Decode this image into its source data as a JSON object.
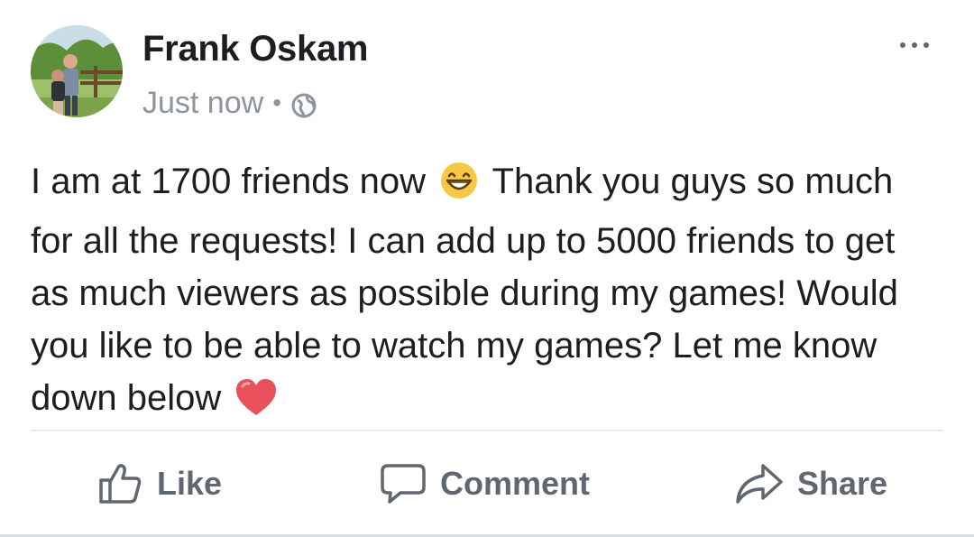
{
  "post": {
    "author": "Frank Oskam",
    "timestamp": "Just now",
    "separator": "•",
    "privacy_icon": "globe-icon",
    "more_icon": "more-options-icon",
    "text_line_1a": "I am at 1700 friends now",
    "text_line_1b": "Thank you guys so much for all the requests! I can add up to 5000 friends to get as much viewers as possible during my games! Would you like to be able to watch my games? Let me know down below",
    "emoji_1": "grinning-face-emoji",
    "emoji_2": "red-heart-emoji"
  },
  "actions": {
    "like_label": "Like",
    "comment_label": "Comment",
    "share_label": "Share"
  },
  "colors": {
    "text_primary": "#1c1e21",
    "text_secondary": "#8d949e",
    "action_gray": "#606770",
    "heart": "#e8505b",
    "emoji_yellow": "#f7c844"
  }
}
